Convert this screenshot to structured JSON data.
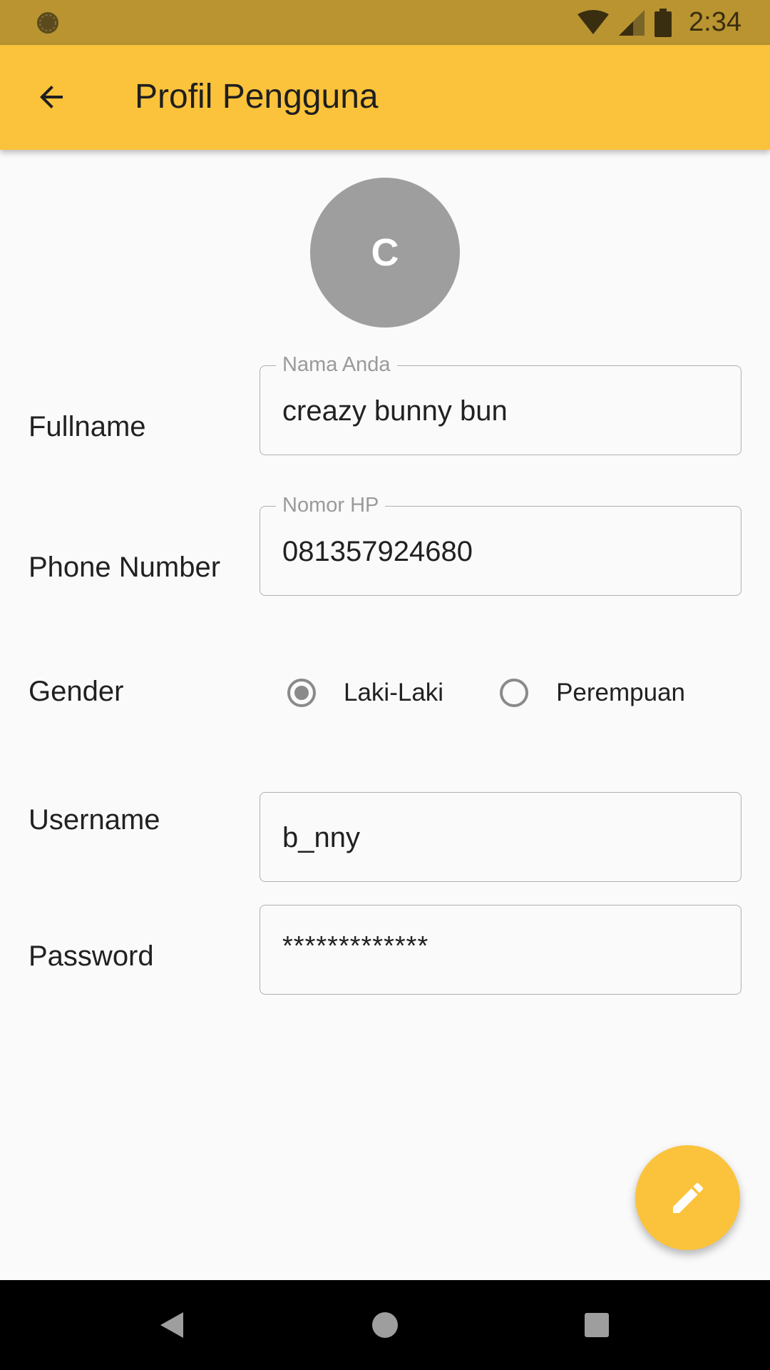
{
  "status_bar": {
    "time": "2:34",
    "icons": [
      "sync-icon",
      "wifi-icon",
      "signal-icon",
      "battery-icon"
    ]
  },
  "app_bar": {
    "title": "Profil Pengguna",
    "back_icon": "arrow-back-icon"
  },
  "avatar": {
    "initial": "C",
    "color": "#9e9e9e"
  },
  "form": {
    "fullname": {
      "label": "Fullname",
      "legend": "Nama Anda",
      "value": "creazy bunny bun"
    },
    "phone": {
      "label": "Phone Number",
      "legend": "Nomor HP",
      "value": "081357924680"
    },
    "gender": {
      "label": "Gender",
      "options": [
        "Laki-Laki",
        "Perempuan"
      ],
      "selected": "Laki-Laki"
    },
    "username": {
      "label": "Username",
      "value": "b_nny"
    },
    "password": {
      "label": "Password",
      "value": "*************"
    }
  },
  "fab": {
    "icon": "edit-pencil-icon"
  },
  "nav_bar": {
    "icons": [
      "nav-back-icon",
      "nav-home-icon",
      "nav-recents-icon"
    ]
  },
  "colors": {
    "status_bar": "#b99430",
    "app_bar": "#fbc33c",
    "fab": "#fbc33c",
    "background": "#fafafa"
  }
}
